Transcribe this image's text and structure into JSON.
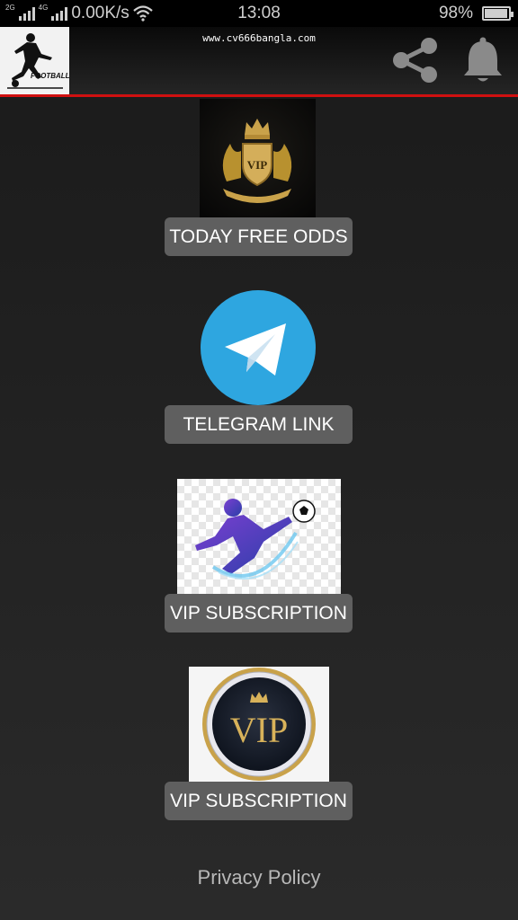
{
  "status_bar": {
    "signal_tag_1": "2G",
    "signal_tag_2": "4G",
    "net_speed": "0.00K/s",
    "time": "13:08",
    "battery": "98%",
    "battery_level": 0.98
  },
  "app_bar": {
    "logo_text": "FOOTBALL",
    "url": "www.cv666bangla.com",
    "share_icon": "share-icon",
    "bell_icon": "bell-icon"
  },
  "items": [
    {
      "image": "vip-crown-crest",
      "label": "TODAY FREE ODDS"
    },
    {
      "image": "telegram-logo",
      "label": "TELEGRAM LINK"
    },
    {
      "image": "football-player-kick",
      "label": "VIP SUBSCRIPTION"
    },
    {
      "image": "vip-gold-badge",
      "label": "VIP SUBSCRIPTION"
    }
  ],
  "crest_text": "VIP",
  "badge_text": "VIP",
  "footer": {
    "privacy_label": "Privacy Policy"
  },
  "colors": {
    "accent_line": "#d01010",
    "telegram_blue": "#2ea6e0",
    "button_bg": "#5f5f5f"
  }
}
